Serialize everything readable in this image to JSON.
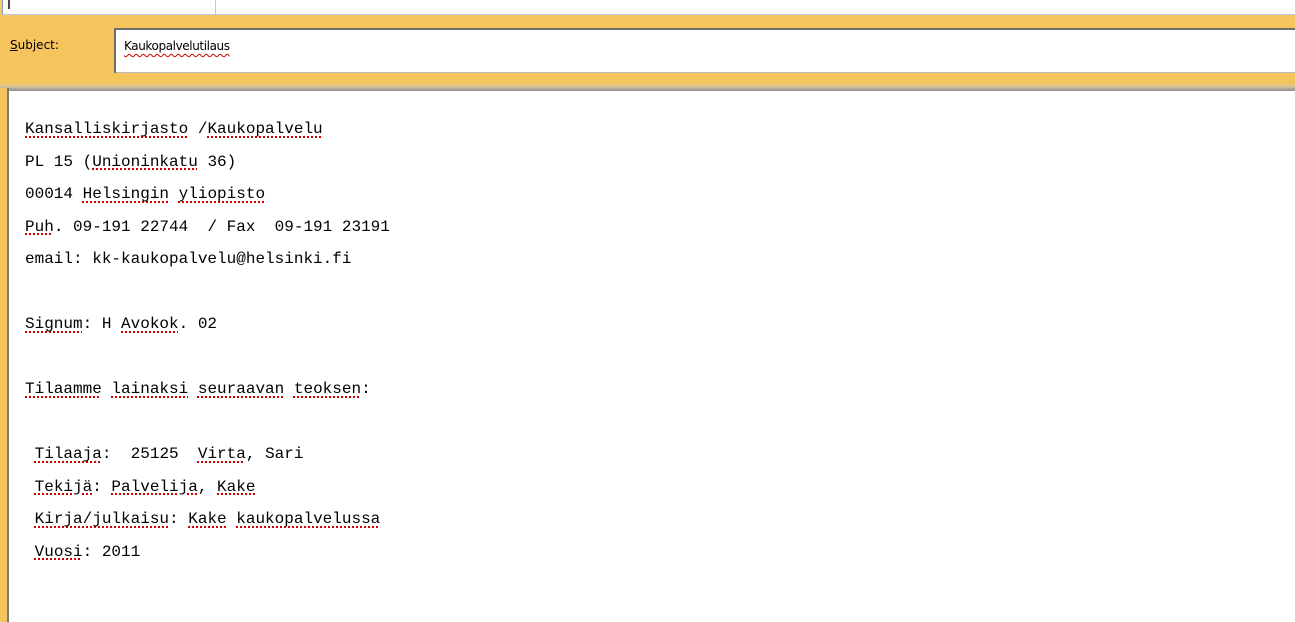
{
  "subject": {
    "label_accel": "S",
    "label_rest": "ubject:",
    "value": "Kaukopalvelutilaus"
  },
  "body": {
    "lines": [
      [
        "Kansalliskirjasto",
        " /",
        "Kaukopalvelu"
      ],
      [
        "PL 15 (",
        "Unioninkatu",
        " 36)"
      ],
      [
        "00014 ",
        "Helsingin",
        " ",
        "yliopisto"
      ],
      [
        "Puh",
        ". 09-191 22744  / Fax  09-191 23191"
      ],
      [
        "email: kk-kaukopalvelu@helsinki.fi"
      ],
      [
        ""
      ],
      [
        "Signum",
        ": H ",
        "Avokok",
        ". 02"
      ],
      [
        ""
      ],
      [
        "Tilaamme",
        " ",
        "lainaksi",
        " ",
        "seuraavan",
        " ",
        "teoksen",
        ":"
      ],
      [
        ""
      ],
      [
        " ",
        "Tilaaja",
        ":  25125  ",
        "Virta",
        ", Sari"
      ],
      [
        " ",
        "Tekijä",
        ": ",
        "Palvelija",
        ", ",
        "Kake"
      ],
      [
        " ",
        "Kirja/julkaisu",
        ": ",
        "Kake",
        " ",
        "kaukopalvelussa"
      ],
      [
        " ",
        "Vuosi",
        ": 2011"
      ]
    ],
    "misspelled": [
      [
        0,
        2
      ],
      [
        1
      ],
      [
        1,
        3
      ],
      [
        0
      ],
      [],
      [],
      [
        0,
        2
      ],
      [],
      [
        0,
        2,
        4,
        6
      ],
      [],
      [
        1,
        3
      ],
      [
        1,
        3,
        5
      ],
      [
        1,
        3,
        5
      ],
      [
        1
      ]
    ]
  }
}
